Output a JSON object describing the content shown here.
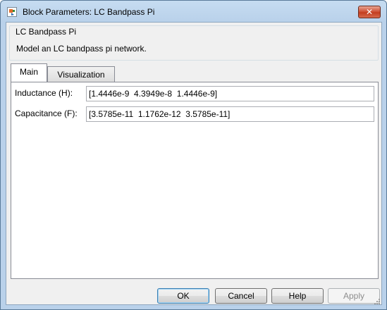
{
  "window": {
    "title": "Block Parameters: LC Bandpass Pi",
    "close_glyph": "✕"
  },
  "description": {
    "group_title": "LC Bandpass Pi",
    "text": "Model an LC bandpass pi network."
  },
  "tabs": [
    {
      "label": "Main",
      "active": true
    },
    {
      "label": "Visualization",
      "active": false
    }
  ],
  "parameters": {
    "inductance": {
      "label": "Inductance (H):",
      "value": "[1.4446e-9  4.3949e-8  1.4446e-9]"
    },
    "capacitance": {
      "label": "Capacitance (F):",
      "value": "[3.5785e-11  1.1762e-12  3.5785e-11]"
    }
  },
  "buttons": {
    "ok": "OK",
    "cancel": "Cancel",
    "help": "Help",
    "apply": "Apply"
  },
  "colors": {
    "titlebar": "#b9d1ea",
    "close_button": "#c33d1f",
    "dialog_background": "#f0f0f0"
  }
}
